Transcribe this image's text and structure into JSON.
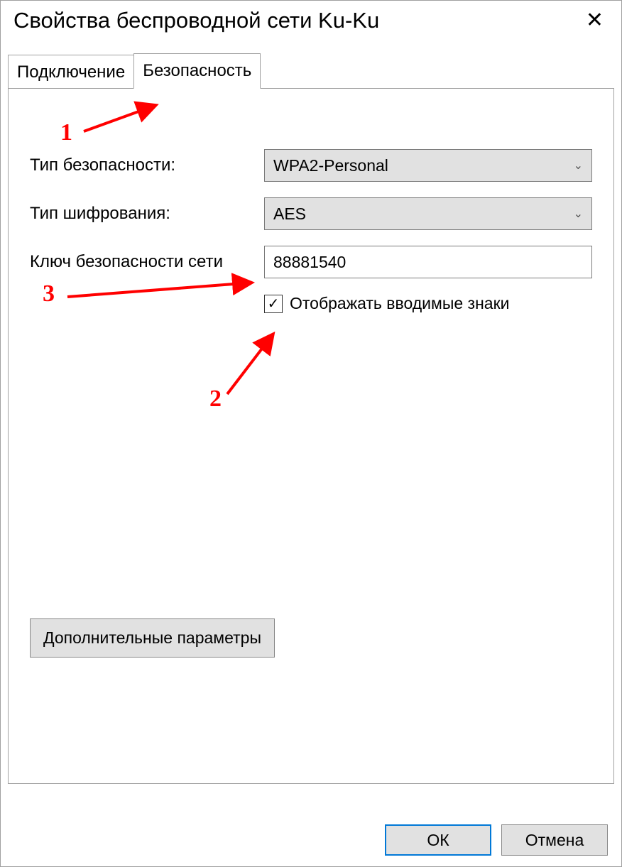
{
  "window": {
    "title": "Свойства беспроводной сети Ku-Ku"
  },
  "tabs": {
    "connection": "Подключение",
    "security": "Безопасность"
  },
  "form": {
    "securityTypeLabel": "Тип безопасности:",
    "securityTypeValue": "WPA2-Personal",
    "encryptionTypeLabel": "Тип шифрования:",
    "encryptionTypeValue": "AES",
    "networkKeyLabel": "Ключ безопасности сети",
    "networkKeyValue": "88881540",
    "showCharsLabel": "Отображать вводимые знаки",
    "advancedBtn": "Дополнительные параметры"
  },
  "footer": {
    "ok": "ОК",
    "cancel": "Отмена"
  },
  "annotations": {
    "n1": "1",
    "n2": "2",
    "n3": "3"
  }
}
